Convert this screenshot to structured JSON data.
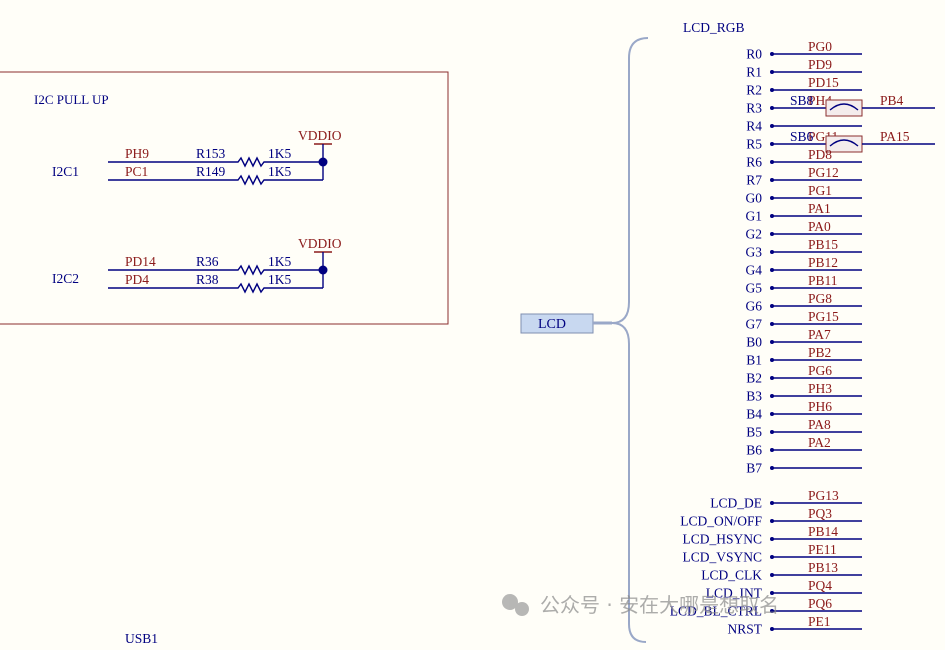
{
  "i2c_section": {
    "title": "I2C PULL UP",
    "groups": [
      {
        "bus": "I2C1",
        "supply": "VDDIO",
        "lines": [
          {
            "net": "PH9",
            "resistor": "R153",
            "value": "1K5"
          },
          {
            "net": "PC1",
            "resistor": "R149",
            "value": "1K5"
          }
        ]
      },
      {
        "bus": "I2C2",
        "supply": "VDDIO",
        "lines": [
          {
            "net": "PD14",
            "resistor": "R36",
            "value": "1K5"
          },
          {
            "net": "PD4",
            "resistor": "R38",
            "value": "1K5"
          }
        ]
      }
    ]
  },
  "lcd_port": {
    "label": "LCD"
  },
  "lcd_rgb": {
    "title": "LCD_RGB",
    "pins": [
      {
        "pin": "R0",
        "net": "PG0"
      },
      {
        "pin": "R1",
        "net": "PD9"
      },
      {
        "pin": "R2",
        "net": "PD15"
      },
      {
        "pin": "R3",
        "net": "PH4",
        "jumper": "SB8",
        "jumper_net": "PB4"
      },
      {
        "pin": "R4",
        "net": ""
      },
      {
        "pin": "R5",
        "net": "PG11",
        "jumper": "SB6",
        "jumper_net": "PA15"
      },
      {
        "pin": "R6",
        "net": "PD8"
      },
      {
        "pin": "R7",
        "net": "PG12"
      },
      {
        "pin": "G0",
        "net": "PG1"
      },
      {
        "pin": "G1",
        "net": "PA1"
      },
      {
        "pin": "G2",
        "net": "PA0"
      },
      {
        "pin": "G3",
        "net": "PB15"
      },
      {
        "pin": "G4",
        "net": "PB12"
      },
      {
        "pin": "G5",
        "net": "PB11"
      },
      {
        "pin": "G6",
        "net": "PG8"
      },
      {
        "pin": "G7",
        "net": "PG15"
      },
      {
        "pin": "B0",
        "net": "PA7"
      },
      {
        "pin": "B1",
        "net": "PB2"
      },
      {
        "pin": "B2",
        "net": "PG6"
      },
      {
        "pin": "B3",
        "net": "PH3"
      },
      {
        "pin": "B4",
        "net": "PH6"
      },
      {
        "pin": "B5",
        "net": "PA8"
      },
      {
        "pin": "B6",
        "net": "PA2"
      },
      {
        "pin": "B7",
        "net": ""
      }
    ],
    "ctrl_pins": [
      {
        "pin": "LCD_DE",
        "net": "PG13"
      },
      {
        "pin": "LCD_ON/OFF",
        "net": "PQ3"
      },
      {
        "pin": "LCD_HSYNC",
        "net": "PB14"
      },
      {
        "pin": "LCD_VSYNC",
        "net": "PE11"
      },
      {
        "pin": "LCD_CLK",
        "net": "PB13"
      },
      {
        "pin": "LCD_INT",
        "net": "PQ4"
      },
      {
        "pin": "LCD_BL_CTRL",
        "net": "PQ6"
      },
      {
        "pin": "NRST",
        "net": "PE1"
      }
    ]
  },
  "usb_label": "USB1",
  "watermark": "公众号 · 安在大哪是想取名",
  "colors": {
    "wire": "#000080",
    "net_label": "#8b1a1a",
    "pin_text": "#000080",
    "box_border": "#8b2e2e",
    "bus_bracket": "#9aa8c8",
    "port_fill": "#c8d8f0",
    "background": "#fffef8"
  }
}
